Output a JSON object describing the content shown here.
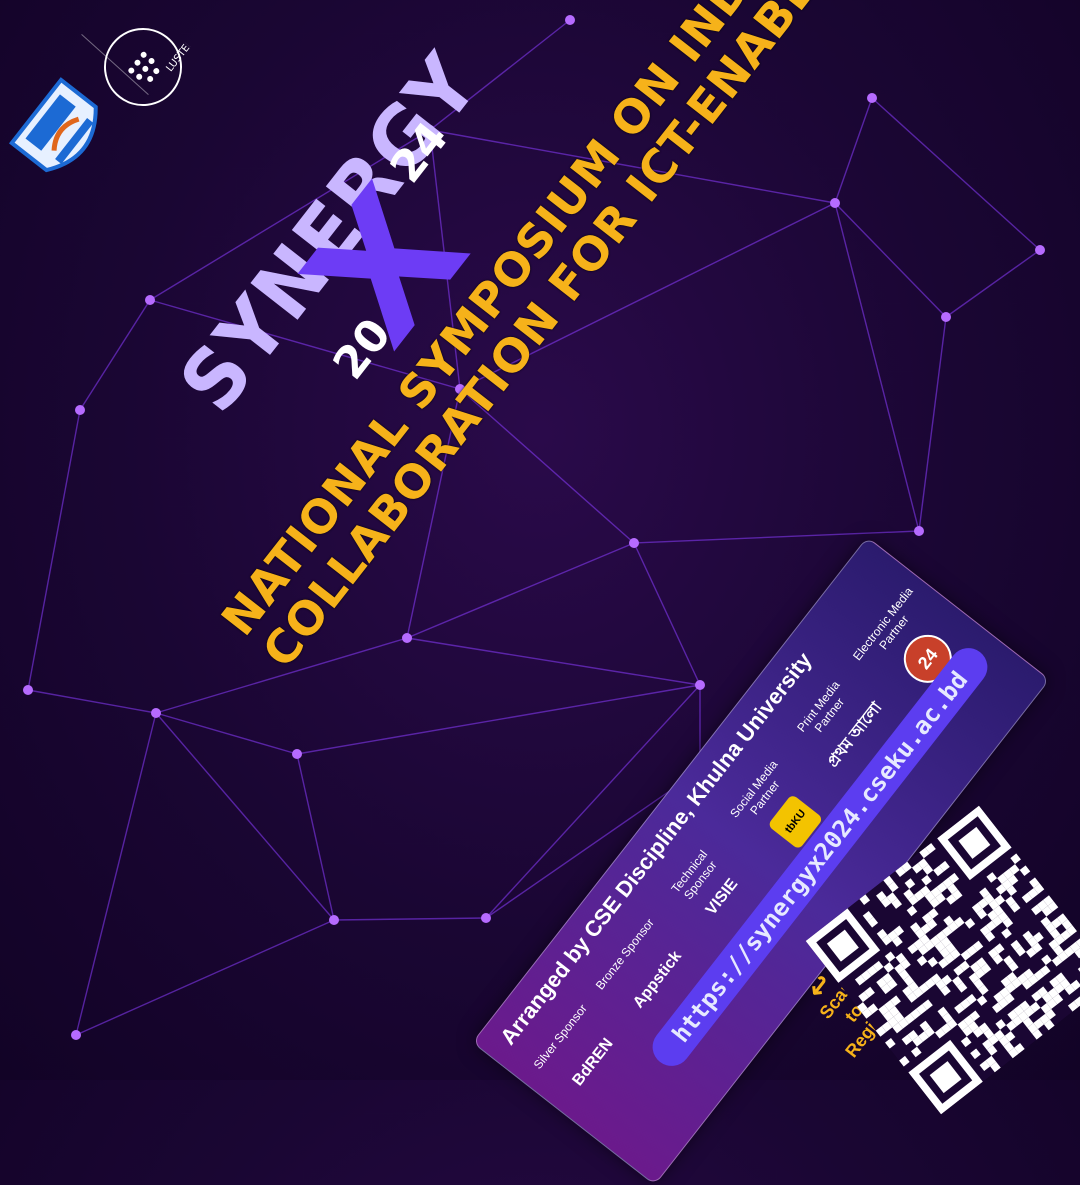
{
  "event": {
    "name": "SYNERGY",
    "year_part_1": "20",
    "year_part_2": "24",
    "x_mark": "X",
    "headline_line_1": "NATIONAL SYMPOSIUM ON INDUSTRY-ACADEMIA",
    "headline_line_2": "COLLABORATION FOR ICT-ENABLED BANGLADESH"
  },
  "panel": {
    "arranged_by": "Arranged by CSE Discipline, Khulna University",
    "sponsors": [
      {
        "role": "Silver Sponsor",
        "name": "BdREN"
      },
      {
        "role": "Bronze Sponsor",
        "name": "Appstick"
      },
      {
        "role": "Technical Sponsor",
        "name": "VISIE"
      },
      {
        "role": "Social Media Partner",
        "name": "tbKU"
      },
      {
        "role": "Print Media Partner",
        "name": "প্রথম আলো"
      },
      {
        "role": "Electronic Media Partner",
        "name": "24"
      }
    ]
  },
  "registration": {
    "url": "https://synergyx2024.cseku.ac.bd",
    "scan_line_1": "Scan",
    "scan_line_2": "to",
    "scan_line_3": "Register"
  },
  "logos": {
    "cluster_text": "LUSTER"
  },
  "colors": {
    "accent_yellow": "#f6b21a",
    "accent_purple": "#6d3cf5",
    "pill_blue": "#5c3df0",
    "node": "#b66bff"
  },
  "icons": [
    "university-logo-icon",
    "cluster-logo-icon",
    "qr-code-icon",
    "curved-arrow-icon"
  ]
}
